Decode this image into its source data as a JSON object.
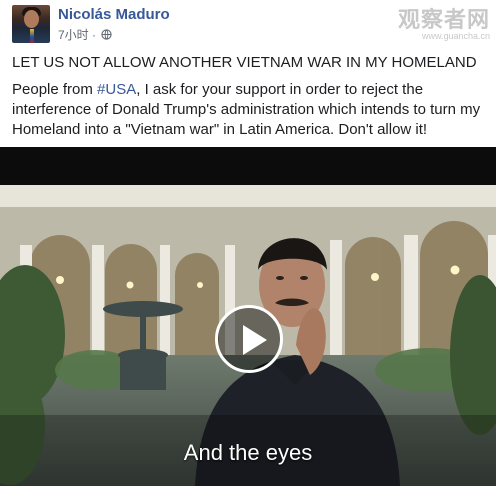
{
  "post": {
    "author": "Nicolás Maduro",
    "time": "7小时 ·",
    "title": "LET US NOT ALLOW ANOTHER VIETNAM WAR IN MY HOMELAND",
    "body_prefix": "People from ",
    "hashtag": "#USA",
    "body_suffix": ", I ask for your support in order to reject the interference of Donald Trump's administration which intends to turn my Homeland into a \"Vietnam war\" in Latin America. Don't allow it!",
    "privacy_icon": "globe-icon"
  },
  "watermark": {
    "name": "观察者网",
    "url": "www.guancha.cn"
  },
  "video": {
    "caption": "And the eyes",
    "play_icon": "play-icon"
  },
  "colors": {
    "link": "#385898",
    "text": "#1c1e21",
    "meta": "#606770"
  }
}
